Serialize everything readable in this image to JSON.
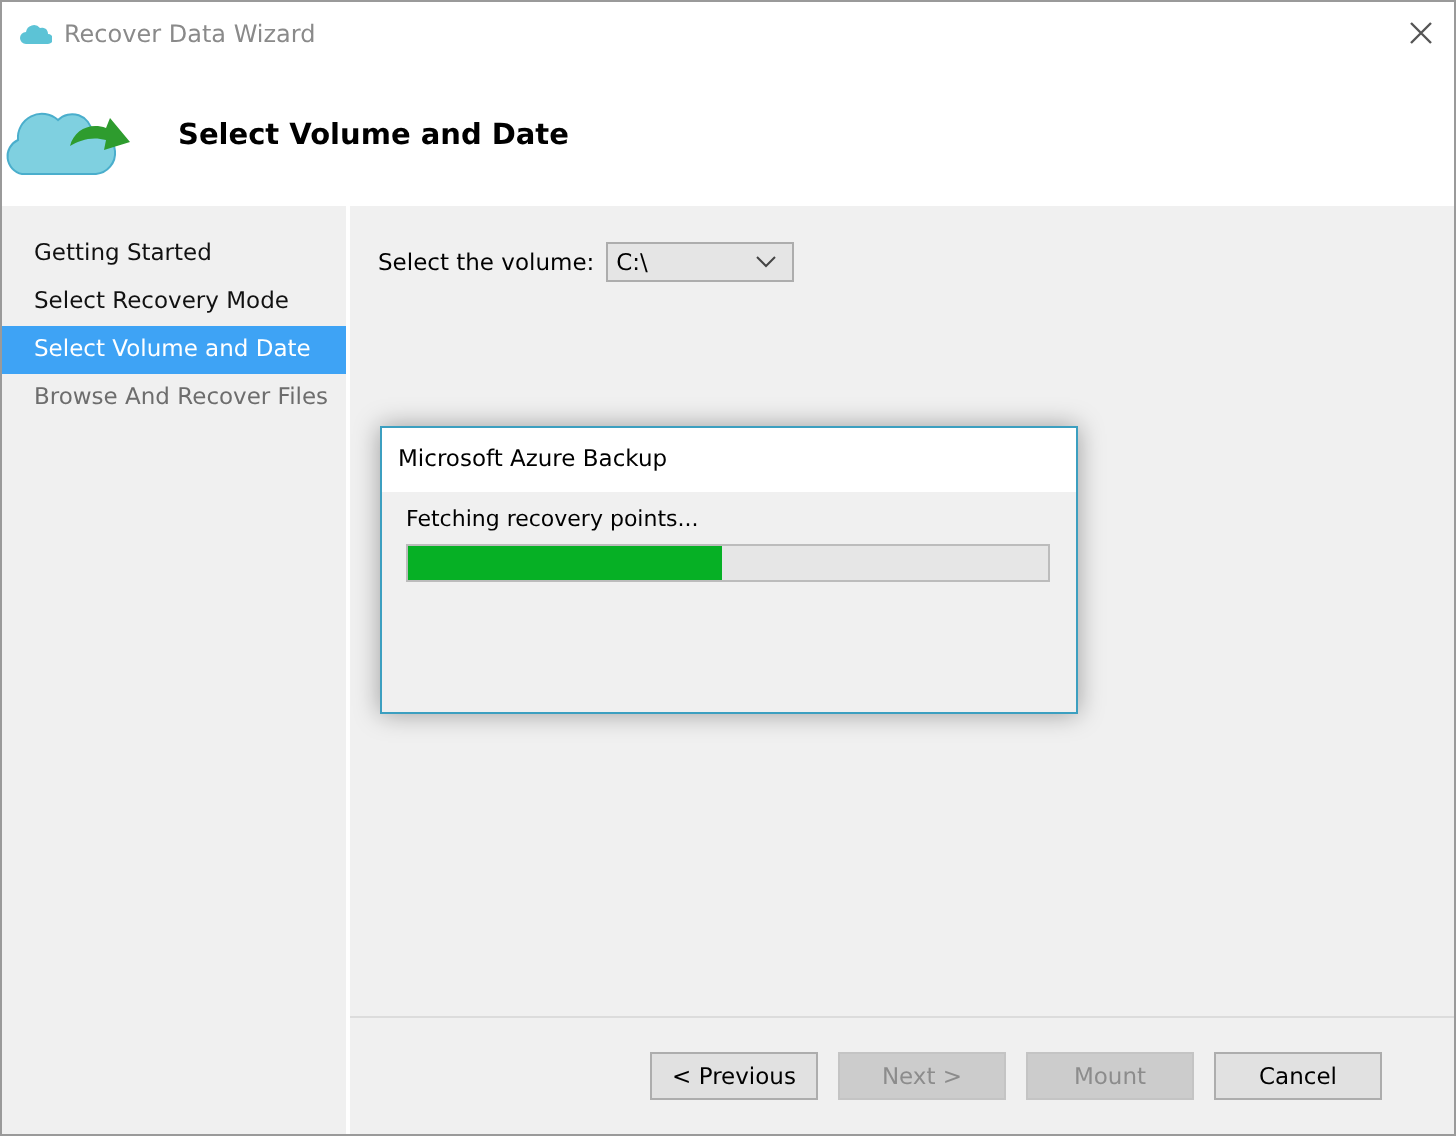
{
  "window": {
    "title": "Recover Data Wizard"
  },
  "header": {
    "title": "Select Volume and Date"
  },
  "sidebar": {
    "items": [
      {
        "label": "Getting Started",
        "selected": false,
        "disabled": false
      },
      {
        "label": "Select Recovery Mode",
        "selected": false,
        "disabled": false
      },
      {
        "label": "Select Volume and Date",
        "selected": true,
        "disabled": false
      },
      {
        "label": "Browse And Recover Files",
        "selected": false,
        "disabled": true
      }
    ]
  },
  "volume": {
    "label": "Select the volume:",
    "value": "C:\\"
  },
  "dialog": {
    "title": "Microsoft Azure Backup",
    "message": "Fetching recovery points...",
    "level": 0.49
  },
  "buttons": [
    {
      "label": "< Previous",
      "disabled": false
    },
    {
      "label": "Next >",
      "disabled": true
    },
    {
      "label": "Mount",
      "disabled": true
    },
    {
      "label": "Cancel",
      "disabled": false
    }
  ]
}
